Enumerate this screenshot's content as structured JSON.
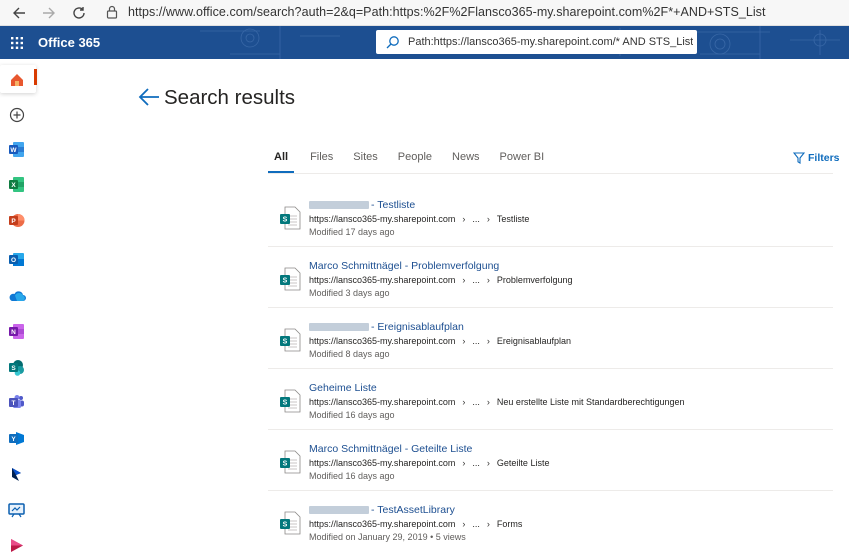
{
  "browser": {
    "url": "https://www.office.com/search?auth=2&q=Path:https:%2F%2Flansco365-my.sharepoint.com%2F*+AND+STS_List"
  },
  "suite": {
    "brand": "Office 365",
    "search_value": "Path:https://lansco365-my.sharepoint.com/* AND STS_List",
    "header_color": "#1d4f91"
  },
  "rail": {
    "icons": [
      "home-icon",
      "create-icon",
      "word-icon",
      "excel-icon",
      "powerpoint-icon",
      "outlook-icon",
      "onedrive-icon",
      "onenote-icon",
      "sharepoint-icon",
      "teams-icon",
      "yammer-icon",
      "dynamics-icon",
      "whiteboard-icon",
      "stream-icon"
    ]
  },
  "page": {
    "title": "Search results"
  },
  "tabs": [
    {
      "label": "All",
      "active": true
    },
    {
      "label": "Files",
      "active": false
    },
    {
      "label": "Sites",
      "active": false
    },
    {
      "label": "People",
      "active": false
    },
    {
      "label": "News",
      "active": false
    },
    {
      "label": "Power BI",
      "active": false
    }
  ],
  "filters_label": "Filters",
  "results": [
    {
      "title": "- Testliste",
      "redacted": true,
      "host": "https://lansco365-my.sharepoint.com",
      "ellipsis": "...",
      "leaf": "Testliste",
      "meta": "Modified 17 days ago"
    },
    {
      "title": "Marco Schmittnägel - Problemverfolgung",
      "redacted": false,
      "host": "https://lansco365-my.sharepoint.com",
      "ellipsis": "...",
      "leaf": "Problemverfolgung",
      "meta": "Modified 3 days ago"
    },
    {
      "title": "- Ereignisablaufplan",
      "redacted": true,
      "host": "https://lansco365-my.sharepoint.com",
      "ellipsis": "...",
      "leaf": "Ereignisablaufplan",
      "meta": "Modified 8 days ago"
    },
    {
      "title": "Geheime Liste",
      "redacted": false,
      "host": "https://lansco365-my.sharepoint.com",
      "ellipsis": "...",
      "leaf": "Neu erstellte Liste mit Standardberechtigungen",
      "meta": "Modified 16 days ago"
    },
    {
      "title": "Marco Schmittnägel - Geteilte Liste",
      "redacted": false,
      "host": "https://lansco365-my.sharepoint.com",
      "ellipsis": "...",
      "leaf": "Geteilte Liste",
      "meta": "Modified 16 days ago"
    },
    {
      "title": "- TestAssetLibrary",
      "redacted": true,
      "host": "https://lansco365-my.sharepoint.com",
      "ellipsis": "...",
      "leaf": "Forms",
      "meta": "Modified on January 29, 2019 • 5 views"
    }
  ]
}
